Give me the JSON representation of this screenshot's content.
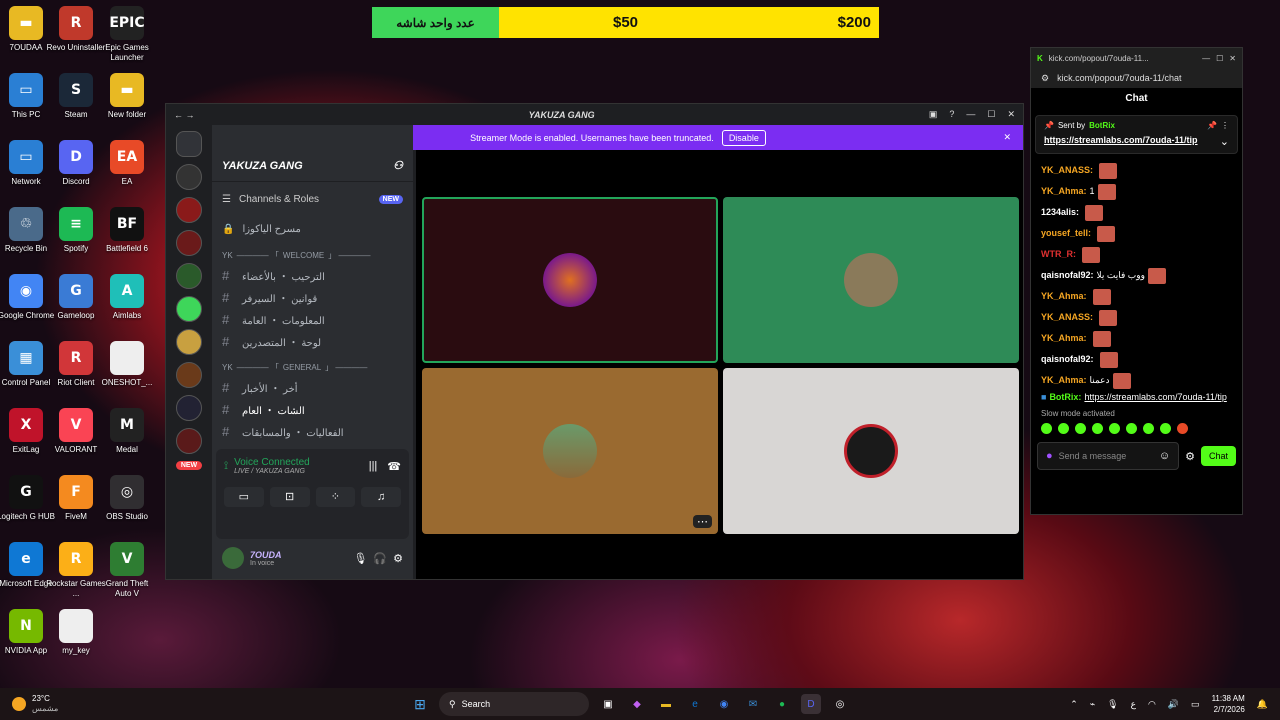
{
  "desktop_icons": [
    {
      "label": "7OUDAA",
      "color": "#e8b923",
      "glyph": "▬"
    },
    {
      "label": "Revo Uninstaller",
      "color": "#c0392b",
      "glyph": "R"
    },
    {
      "label": "Epic Games Launcher",
      "color": "#222",
      "glyph": "EPIC"
    },
    {
      "label": "This PC",
      "color": "#2a7fd4",
      "glyph": "▭"
    },
    {
      "label": "Steam",
      "color": "#1b2838",
      "glyph": "S"
    },
    {
      "label": "New folder",
      "color": "#e8b923",
      "glyph": "▬"
    },
    {
      "label": "Network",
      "color": "#2a7fd4",
      "glyph": "▭"
    },
    {
      "label": "Discord",
      "color": "#5865f2",
      "glyph": "D"
    },
    {
      "label": "EA",
      "color": "#e84a27",
      "glyph": "EA"
    },
    {
      "label": "Recycle Bin",
      "color": "#4a6a8a",
      "glyph": "♲"
    },
    {
      "label": "Spotify",
      "color": "#1db954",
      "glyph": "≡"
    },
    {
      "label": "Battlefield 6",
      "color": "#111",
      "glyph": "BF"
    },
    {
      "label": "Google Chrome",
      "color": "#4285f4",
      "glyph": "◉"
    },
    {
      "label": "Gameloop",
      "color": "#3a7bd5",
      "glyph": "G"
    },
    {
      "label": "Aimlabs",
      "color": "#1fbfb8",
      "glyph": "A"
    },
    {
      "label": "Control Panel",
      "color": "#3a8fd8",
      "glyph": "▦"
    },
    {
      "label": "Riot Client",
      "color": "#d13639",
      "glyph": "R"
    },
    {
      "label": "ONESHOT_...",
      "color": "#eee",
      "glyph": ""
    },
    {
      "label": "ExitLag",
      "color": "#c0132a",
      "glyph": "X"
    },
    {
      "label": "VALORANT",
      "color": "#fa4454",
      "glyph": "V"
    },
    {
      "label": "Medal",
      "color": "#222",
      "glyph": "M"
    },
    {
      "label": "Logitech G HUB",
      "color": "#111",
      "glyph": "G"
    },
    {
      "label": "FiveM",
      "color": "#f48a1f",
      "glyph": "F"
    },
    {
      "label": "OBS Studio",
      "color": "#302e31",
      "glyph": "◎"
    },
    {
      "label": "Microsoft Edge",
      "color": "#0f78d4",
      "glyph": "e"
    },
    {
      "label": "Rockstar Games ...",
      "color": "#fcaf17",
      "glyph": "R"
    },
    {
      "label": "Grand Theft Auto V",
      "color": "#2e7d32",
      "glyph": "V"
    },
    {
      "label": "NVIDIA App",
      "color": "#76b900",
      "glyph": "N"
    },
    {
      "label": "my_key",
      "color": "#eee",
      "glyph": ""
    }
  ],
  "donation_bar": {
    "left_text": "عدد واحد شاشه",
    "mid_value": "$50",
    "right_value": "$200"
  },
  "discord": {
    "window_title": "YAKUZA GANG",
    "banner_text": "Streamer Mode is enabled. Usernames have been truncated.",
    "banner_button": "Disable",
    "server_name": "YAKUZA GANG",
    "channels_roles": "Channels & Roles",
    "new_badge": "NEW",
    "stage_channel": "مسرح الياكوزا",
    "categories": [
      {
        "prefix": "YK",
        "name": "WELCOME",
        "channels": [
          "الترحيب ・ بالأعضاء",
          "قوانين ・ السيرفر",
          "المعلومات ・ العامة",
          "لوحة ・ المتصدرين"
        ]
      },
      {
        "prefix": "YK",
        "name": "GENERAL",
        "channels": [
          "أخر ・ الأخبار",
          "الشات ・ العام",
          "الفعاليات ・ والمسابقات"
        ]
      }
    ],
    "new_pill": "NEW",
    "voice_connected": "Voice Connected",
    "voice_sub": "LIVE / YAKUZA GANG",
    "user_name": "7OUDA",
    "user_status": "In voice"
  },
  "chat": {
    "tab_url": "kick.com/popout/7ouda-11...",
    "address": "kick.com/popout/7ouda-11/chat",
    "title": "Chat",
    "pinned_by": "Sent by",
    "pinned_user": "BotRix",
    "pinned_link": "https://streamlabs.com/7ouda-11/tip",
    "messages": [
      {
        "user": "YK_ANASS:",
        "color": "#f5a623",
        "text": ""
      },
      {
        "user": "YK_Ahma:",
        "color": "#f5a623",
        "text": "1"
      },
      {
        "user": "1234alis:",
        "color": "#fff",
        "text": ""
      },
      {
        "user": "yousef_tell:",
        "color": "#f5a623",
        "text": ""
      },
      {
        "user": "WTR_R:",
        "color": "#e03030",
        "text": ""
      },
      {
        "user": "qaisnofal92:",
        "color": "#fff",
        "text": "ووب فايت يلا"
      },
      {
        "user": "YK_Ahma:",
        "color": "#f5a623",
        "text": ""
      },
      {
        "user": "YK_ANASS:",
        "color": "#f5a623",
        "text": ""
      },
      {
        "user": "YK_Ahma:",
        "color": "#f5a623",
        "text": ""
      },
      {
        "user": "qaisnofal92:",
        "color": "#fff",
        "text": ""
      },
      {
        "user": "YK_Ahma:",
        "color": "#f5a623",
        "text": "دعمنا"
      }
    ],
    "bot_user": "BotRix:",
    "bot_link": "https://streamlabs.com/7ouda-11/tip",
    "slow_mode": "Slow mode activated",
    "input_placeholder": "Send a message",
    "send_button": "Chat"
  },
  "taskbar": {
    "weather_temp": "23°C",
    "weather_desc": "مشمس",
    "search": "Search",
    "time": "11:38 AM",
    "date": "2/7/2026",
    "lang": "ع"
  }
}
